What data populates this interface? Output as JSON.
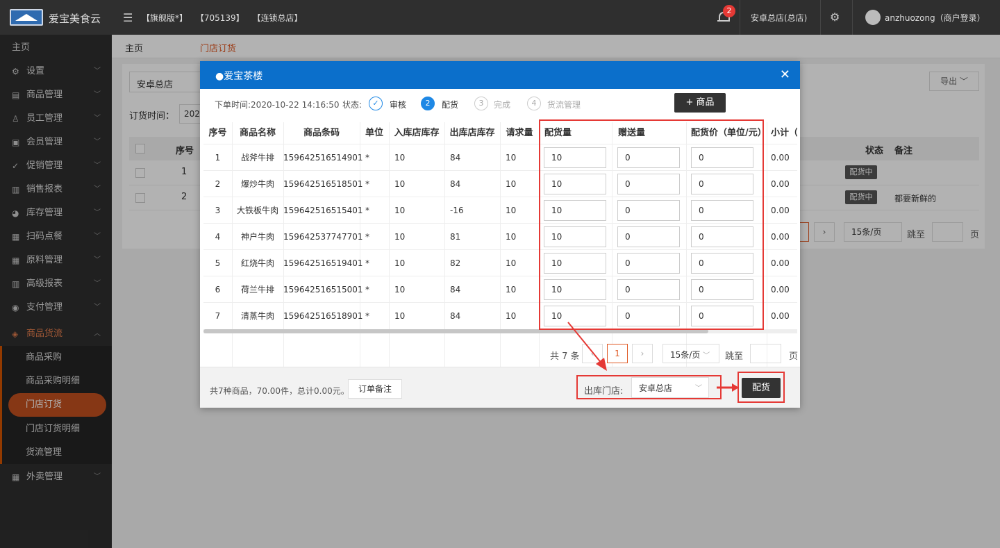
{
  "app": {
    "brand": "爱宝美食云",
    "tags": [
      "【旗舰版*】",
      "【705139】",
      "【连锁总店】"
    ],
    "notify_count": "2",
    "store": "安卓总店(总店)",
    "user": "anzhuozong（商户登录）"
  },
  "sidebar": {
    "home": "主页",
    "items": [
      {
        "label": "设置",
        "icon": "gear-icon"
      },
      {
        "label": "商品管理",
        "icon": "goods-icon"
      },
      {
        "label": "员工管理",
        "icon": "staff-icon"
      },
      {
        "label": "会员管理",
        "icon": "member-icon"
      },
      {
        "label": "促销管理",
        "icon": "promo-icon"
      },
      {
        "label": "销售报表",
        "icon": "chart-icon"
      },
      {
        "label": "库存管理",
        "icon": "stock-icon"
      },
      {
        "label": "扫码点餐",
        "icon": "scan-icon"
      },
      {
        "label": "原料管理",
        "icon": "material-icon"
      },
      {
        "label": "高级报表",
        "icon": "report-icon"
      },
      {
        "label": "支付管理",
        "icon": "pay-icon"
      },
      {
        "label": "商品货流",
        "icon": "flow-icon"
      },
      {
        "label": "外卖管理",
        "icon": "takeout-icon"
      }
    ],
    "sub_items": [
      "商品采购",
      "商品采购明细",
      "门店订货",
      "门店订货明细",
      "货流管理"
    ]
  },
  "breadcrumb": {
    "home": "主页",
    "current": "门店订货"
  },
  "background": {
    "store_select": "安卓总店",
    "export": "导出",
    "order_time_label": "订货时间：",
    "date_value": "202",
    "headers": {
      "seq": "序号",
      "status": "状态",
      "remark": "备注"
    },
    "rows": [
      {
        "seq": "1",
        "status": "配货中",
        "remark": ""
      },
      {
        "seq": "2",
        "status": "配货中",
        "remark": "都要新鲜的"
      }
    ],
    "page_size": "15条/页",
    "jump": "跳至",
    "page": "页"
  },
  "modal": {
    "title": "●爱宝茶楼",
    "order_time": "下单时间:2020-10-22 14:16:50",
    "status_label": "状态:",
    "steps": [
      {
        "num": "✓",
        "label": "审核"
      },
      {
        "num": "2",
        "label": "配货"
      },
      {
        "num": "3",
        "label": "完成"
      },
      {
        "num": "4",
        "label": "货流管理"
      }
    ],
    "add_goods": "+ 商品",
    "columns": [
      "序号",
      "商品名称",
      "商品条码",
      "单位",
      "入库店库存",
      "出库店库存",
      "请求量",
      "配货量",
      "赠送量",
      "配货价（单位/元）",
      "小计（"
    ],
    "rows": [
      {
        "seq": "1",
        "name": "战斧牛排",
        "code": "159642516514901",
        "unit": "*",
        "in_stock": "10",
        "out_stock": "84",
        "request": "10",
        "qty": "10",
        "gift": "0",
        "price": "0",
        "subtotal": "0.00"
      },
      {
        "seq": "2",
        "name": "爆炒牛肉",
        "code": "159642516518501",
        "unit": "*",
        "in_stock": "10",
        "out_stock": "84",
        "request": "10",
        "qty": "10",
        "gift": "0",
        "price": "0",
        "subtotal": "0.00"
      },
      {
        "seq": "3",
        "name": "大铁板牛肉",
        "code": "159642516515401",
        "unit": "*",
        "in_stock": "10",
        "out_stock": "-16",
        "request": "10",
        "qty": "10",
        "gift": "0",
        "price": "0",
        "subtotal": "0.00"
      },
      {
        "seq": "4",
        "name": "神户牛肉",
        "code": "159642537747701",
        "unit": "*",
        "in_stock": "10",
        "out_stock": "81",
        "request": "10",
        "qty": "10",
        "gift": "0",
        "price": "0",
        "subtotal": "0.00"
      },
      {
        "seq": "5",
        "name": "红烧牛肉",
        "code": "159642516519401",
        "unit": "*",
        "in_stock": "10",
        "out_stock": "82",
        "request": "10",
        "qty": "10",
        "gift": "0",
        "price": "0",
        "subtotal": "0.00"
      },
      {
        "seq": "6",
        "name": "荷兰牛排",
        "code": "159642516515001",
        "unit": "*",
        "in_stock": "10",
        "out_stock": "84",
        "request": "10",
        "qty": "10",
        "gift": "0",
        "price": "0",
        "subtotal": "0.00"
      },
      {
        "seq": "7",
        "name": "清蒸牛肉",
        "code": "159642516518901",
        "unit": "*",
        "in_stock": "10",
        "out_stock": "84",
        "request": "10",
        "qty": "10",
        "gift": "0",
        "price": "0",
        "subtotal": "0.00"
      }
    ],
    "pagination": {
      "total": "共 7 条",
      "current": "1",
      "page_size": "15条/页",
      "jump": "跳至",
      "page": "页"
    },
    "footer": {
      "summary": "共7种商品，70.00件，总计0.00元。",
      "remark_btn": "订单备注",
      "outstore_label": "出库门店:",
      "outstore_value": "安卓总店",
      "confirm": "配货"
    }
  }
}
